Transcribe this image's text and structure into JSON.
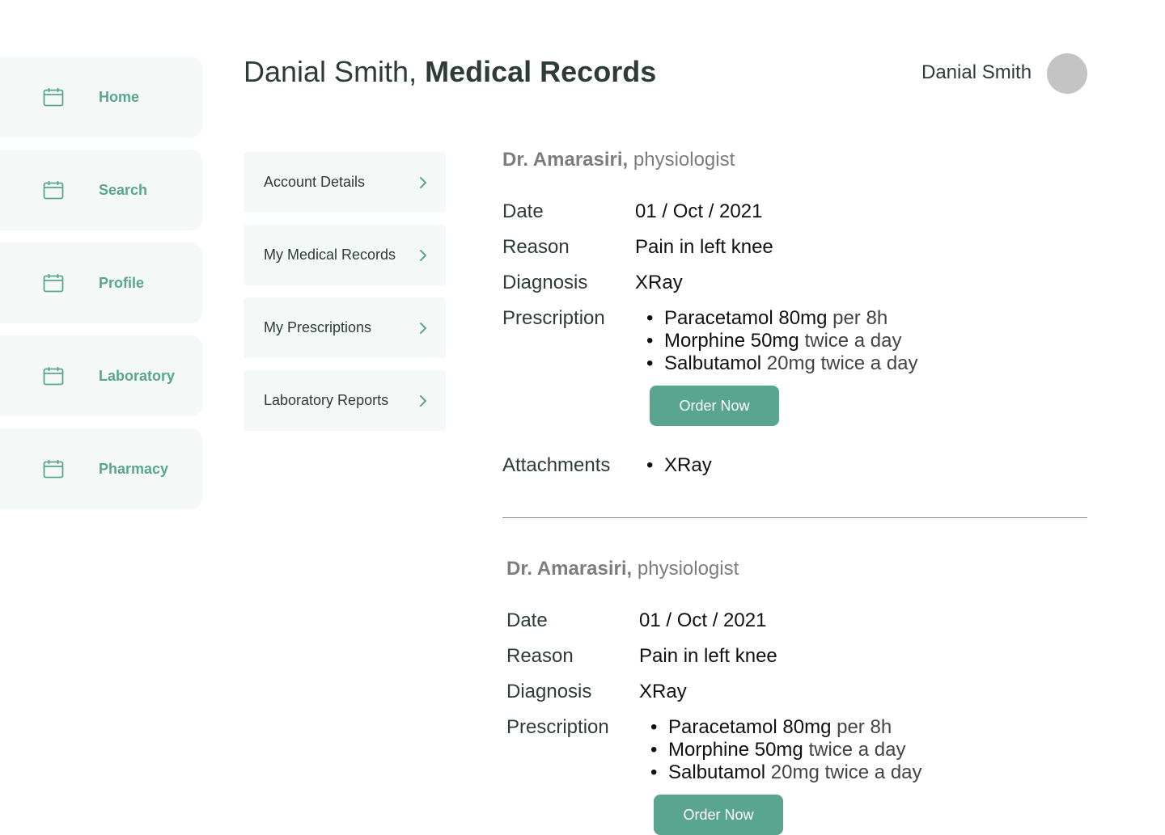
{
  "sidebar": {
    "items": [
      {
        "label": "Home",
        "icon": "calendar-icon"
      },
      {
        "label": "Search",
        "icon": "calendar-icon"
      },
      {
        "label": "Profile",
        "icon": "calendar-icon"
      },
      {
        "label": "Laboratory",
        "icon": "calendar-icon"
      },
      {
        "label": "Pharmacy",
        "icon": "calendar-icon"
      }
    ]
  },
  "header": {
    "title_prefix": "Danial Smith,",
    "title_bold": "Medical Records",
    "user_name": "Danial Smith"
  },
  "submenu": {
    "items": [
      {
        "label": "Account Details",
        "icon": "chevron-right-icon"
      },
      {
        "label": "My Medical Records",
        "icon": "chevron-right-icon"
      },
      {
        "label": "My Prescriptions",
        "icon": "chevron-right-icon"
      },
      {
        "label": "Laboratory Reports",
        "icon": "chevron-right-icon"
      }
    ]
  },
  "labels": {
    "date": "Date",
    "reason": "Reason",
    "diagnosis": "Diagnosis",
    "prescription": "Prescription",
    "attachments": "Attachments",
    "order_button": "Order Now",
    "bullet": "•"
  },
  "records": [
    {
      "doctor": "Dr. Amarasiri,",
      "specialty": "physiologist",
      "date": "01 / Oct / 2021",
      "reason": "Pain in left knee",
      "diagnosis": "XRay",
      "prescriptions": [
        {
          "drug": "Paracetamol 80mg",
          "dosage": "per 8h"
        },
        {
          "drug": "Morphine 50mg",
          "dosage": "twice a day"
        },
        {
          "drug": "Salbutamol",
          "dosage": "20mg twice a day"
        }
      ],
      "attachments": [
        "XRay"
      ]
    },
    {
      "doctor": "Dr. Amarasiri,",
      "specialty": "physiologist",
      "date": "01 / Oct / 2021",
      "reason": "Pain in left knee",
      "diagnosis": "XRay",
      "prescriptions": [
        {
          "drug": "Paracetamol 80mg",
          "dosage": "per 8h"
        },
        {
          "drug": "Morphine 50mg",
          "dosage": "twice a day"
        },
        {
          "drug": "Salbutamol",
          "dosage": "20mg twice a day"
        }
      ]
    }
  ],
  "colors": {
    "accent": "#5aa58f",
    "panel": "#f4f8f6",
    "avatar": "#c4c4c4"
  }
}
